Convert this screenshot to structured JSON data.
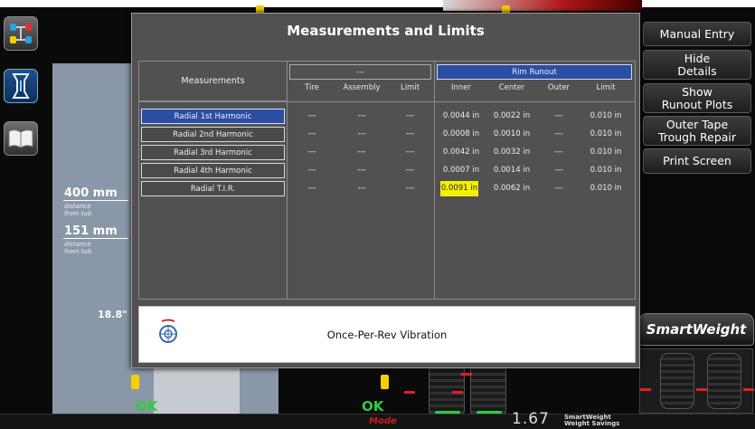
{
  "dialog": {
    "title": "Measurements and Limits",
    "measurements_header": "Measurements",
    "groups": [
      {
        "label": "---",
        "columns": [
          "Tire",
          "Assembly",
          "Limit"
        ]
      },
      {
        "label": "Rim Runout",
        "columns": [
          "Inner",
          "Center",
          "Outer",
          "Limit"
        ]
      }
    ],
    "rows": [
      {
        "label": "Radial 1st Harmonic",
        "selected": true,
        "values": [
          "---",
          "---",
          "---",
          "0.0044 in",
          "0.0022 in",
          "---",
          "0.010 in"
        ]
      },
      {
        "label": "Radial 2nd Harmonic",
        "selected": false,
        "values": [
          "---",
          "---",
          "---",
          "0.0008 in",
          "0.0010 in",
          "---",
          "0.010 in"
        ]
      },
      {
        "label": "Radial 3rd Harmonic",
        "selected": false,
        "values": [
          "---",
          "---",
          "---",
          "0.0042 in",
          "0.0032 in",
          "---",
          "0.010 in"
        ]
      },
      {
        "label": "Radial 4th Harmonic",
        "selected": false,
        "values": [
          "---",
          "---",
          "---",
          "0.0007 in",
          "0.0014 in",
          "---",
          "0.010 in"
        ]
      },
      {
        "label": "Radial T.I.R.",
        "selected": false,
        "values": [
          "---",
          "---",
          "---",
          "0.0091 in",
          "0.0062 in",
          "---",
          "0.010 in"
        ],
        "highlight_index": 3
      }
    ],
    "footer_label": "Once-Per-Rev Vibration"
  },
  "menu": {
    "manual_entry": "Manual Entry",
    "hide_details": "Hide\nDetails",
    "show_runout_plots": "Show\nRunout Plots",
    "outer_tape_trough_repair": "Outer Tape\nTrough Repair",
    "print_screen": "Print Screen"
  },
  "smartweight": {
    "logo": "SmartWeight",
    "value": "1.67",
    "caption_line1": "SmartWeight",
    "caption_line2": "Weight Savings"
  },
  "background": {
    "distance1_value": "400 mm",
    "distance1_caption": "distance\nfrom tub",
    "distance2_value": "151 mm",
    "distance2_caption": "distance\nfrom tub",
    "rim_dimension": "18.8\"",
    "ok_left": "OK",
    "ok_right": "OK",
    "mode_label": "Mode"
  },
  "colors": {
    "accent_blue": "#2b4ea3",
    "highlight_yellow": "#f6f000",
    "ok_green": "#2ecc40",
    "alert_red": "#e81e1e"
  }
}
